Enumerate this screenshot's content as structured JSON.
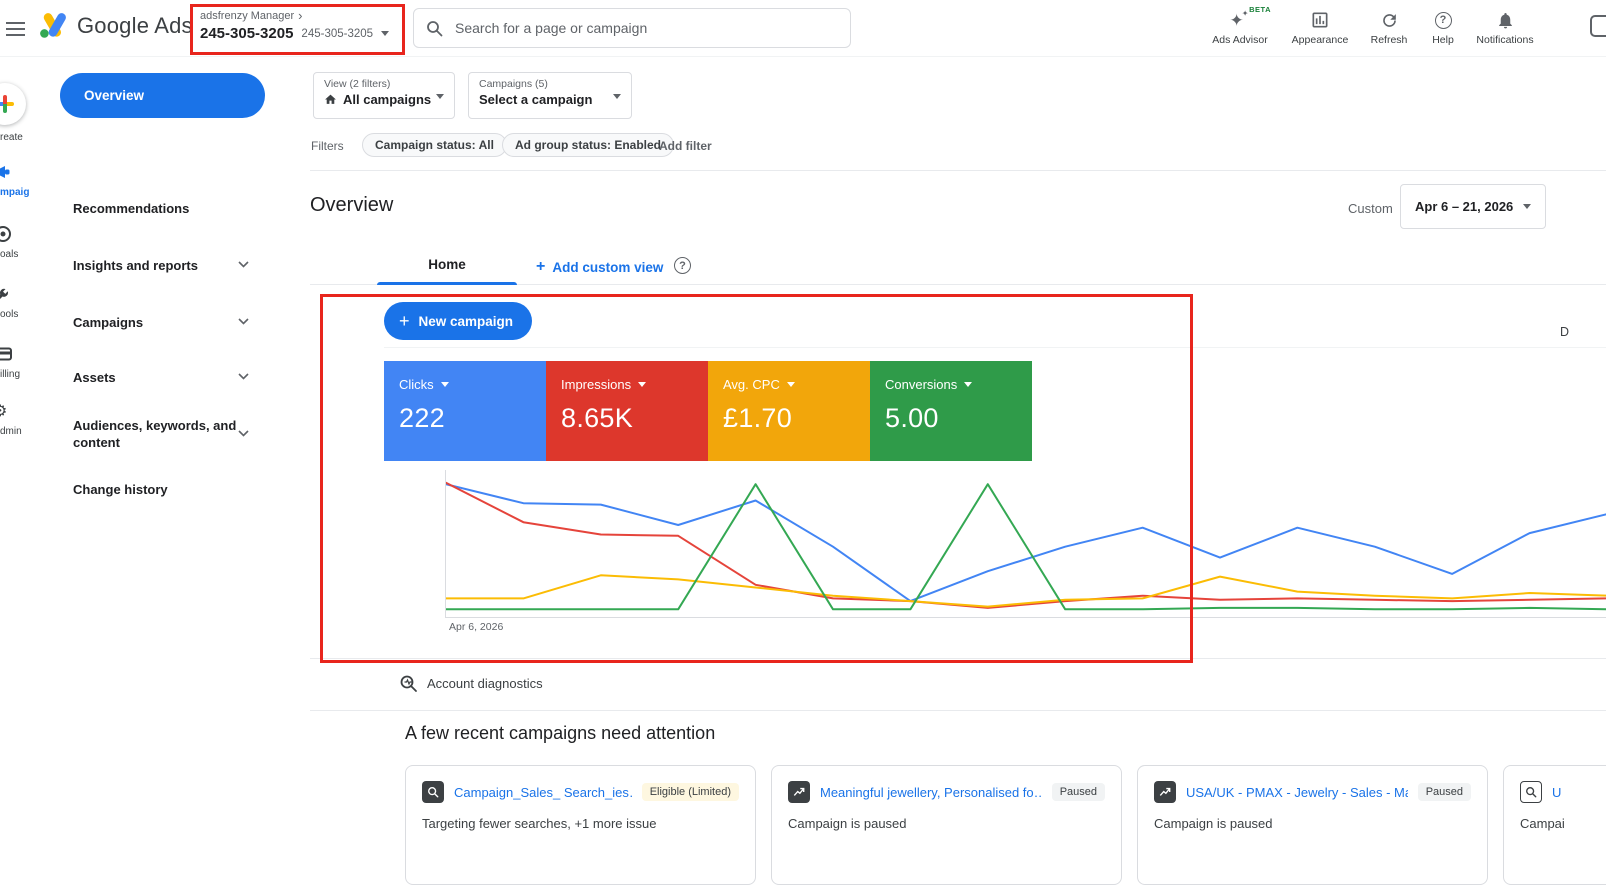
{
  "annotations": {
    "color": "#e8251d"
  },
  "topbar": {
    "product": "Google Ads",
    "account": {
      "manager_label": "adsfrenzy Manager",
      "account_id": "245-305-3205",
      "account_id_secondary": "245-305-3205"
    },
    "search": {
      "placeholder": "Search for a page or campaign"
    },
    "actions": {
      "ads_advisor": "Ads Advisor",
      "ads_advisor_beta": "BETA",
      "appearance": "Appearance",
      "refresh": "Refresh",
      "help": "Help",
      "notifications": "Notifications"
    }
  },
  "rail": {
    "create": "reate",
    "campaigns": "mpaigns",
    "goals": "oals",
    "tools": "ools",
    "billing": "illing",
    "admin": "dmin"
  },
  "nav": {
    "overview": "Overview",
    "recommendations": "Recommendations",
    "insights": "Insights and reports",
    "campaigns": "Campaigns",
    "assets": "Assets",
    "audiences": "Audiences, keywords, and content",
    "change_history": "Change history"
  },
  "toolbar": {
    "view_label": "View (2 filters)",
    "view_value": "All campaigns",
    "campaigns_label": "Campaigns (5)",
    "campaigns_value": "Select a campaign",
    "filters_label": "Filters",
    "chip_campaign_status": "Campaign status: All",
    "chip_ad_group_status": "Ad group status: Enabled",
    "add_filter": "Add filter"
  },
  "page": {
    "title": "Overview",
    "date_mode": "Custom",
    "date_range": "Apr 6 – 21, 2026",
    "edge_partial": "D"
  },
  "tabs": {
    "home": "Home",
    "add_custom_view": "Add custom view"
  },
  "overview_card": {
    "new_campaign": "New campaign"
  },
  "metrics": [
    {
      "label": "Clicks",
      "value": "222",
      "color": "#4285f4"
    },
    {
      "label": "Impressions",
      "value": "8.65K",
      "color": "#dd372c"
    },
    {
      "label": "Avg. CPC",
      "value": "£1.70",
      "color": "#f2a60b"
    },
    {
      "label": "Conversions",
      "value": "5.00",
      "color": "#2f9b49"
    }
  ],
  "chart_data": {
    "type": "line",
    "x_axis_label": "Apr 6, 2026",
    "x_range": [
      "Apr 6, 2026",
      "Apr 21, 2026"
    ],
    "ylim": [
      0,
      100
    ],
    "grid": false,
    "series": [
      {
        "name": "Clicks",
        "color": "#4285f4",
        "values": [
          94,
          80,
          79,
          64,
          82,
          48,
          8,
          30,
          48,
          62,
          40,
          62,
          48,
          28,
          58,
          72
        ]
      },
      {
        "name": "Impressions",
        "color": "#e5443b",
        "values": [
          95,
          66,
          57,
          56,
          20,
          10,
          8,
          3,
          8,
          12,
          9,
          10,
          9,
          8,
          9,
          10
        ]
      },
      {
        "name": "Avg. CPC",
        "color": "#fbbc04",
        "values": [
          10,
          10,
          27,
          24,
          18,
          12,
          8,
          4,
          9,
          10,
          26,
          15,
          12,
          10,
          14,
          12
        ]
      },
      {
        "name": "Conversions",
        "color": "#34a853",
        "values": [
          2,
          2,
          2,
          2,
          94,
          2,
          2,
          94,
          2,
          2,
          3,
          3,
          2,
          2,
          3,
          2
        ]
      }
    ]
  },
  "diagnostics": {
    "label": "Account diagnostics"
  },
  "attention": {
    "heading": "A few recent campaigns need attention",
    "cards": [
      {
        "name": "Campaign_Sales_ Search_ies…",
        "badge": "Eligible (Limited)",
        "description": "Targeting fewer searches, +1 more issue"
      },
      {
        "name": "Meaningful jewellery, Personalised fo…",
        "badge": "Paused",
        "description": "Campaign is paused"
      },
      {
        "name": "USA/UK - PMAX - Jewelry - Sales - Ma…",
        "badge": "Paused",
        "description": "Campaign is paused"
      },
      {
        "name": "U",
        "badge": "",
        "description": "Campai"
      }
    ]
  }
}
